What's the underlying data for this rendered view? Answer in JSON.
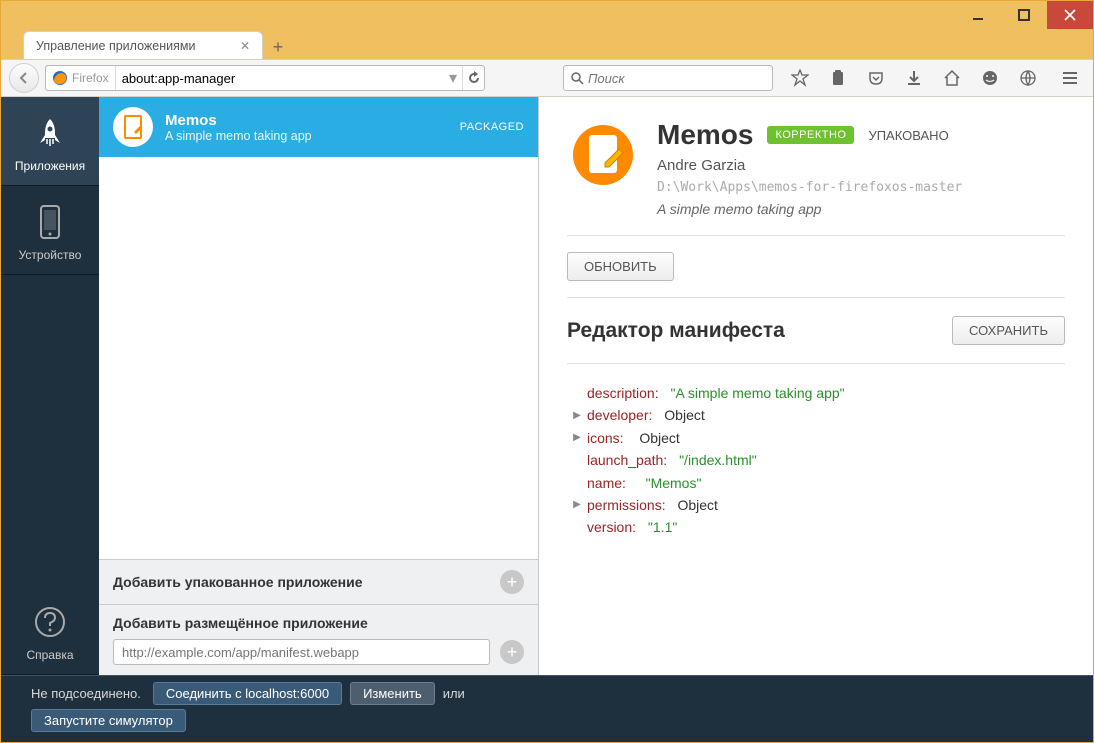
{
  "window": {
    "tab_title": "Управление приложениями"
  },
  "toolbar": {
    "identity_label": "Firefox",
    "url": "about:app-manager",
    "search_placeholder": "Поиск"
  },
  "leftnav": {
    "apps": "Приложения",
    "device": "Устройство",
    "help": "Справка"
  },
  "applist": {
    "item": {
      "name": "Memos",
      "subtitle": "A simple memo taking app",
      "tag": "PACKAGED"
    },
    "add_packaged": "Добавить упакованное приложение",
    "add_hosted": "Добавить размещённое приложение",
    "hosted_placeholder": "http://example.com/app/manifest.webapp"
  },
  "detail": {
    "name": "Memos",
    "valid": "КОРРЕКТНО",
    "packaged": "УПАКОВАНО",
    "author": "Andre Garzia",
    "path": "D:\\Work\\Apps\\memos-for-firefoxos-master",
    "desc": "A simple memo taking app",
    "update_btn": "ОБНОВИТЬ",
    "editor_title": "Редактор манифеста",
    "save_btn": "СОХРАНИТЬ"
  },
  "manifest": {
    "description_k": "description:",
    "description_v": "\"A simple memo taking app\"",
    "developer_k": "developer:",
    "developer_v": "Object",
    "icons_k": "icons:",
    "icons_v": "Object",
    "launch_path_k": "launch_path:",
    "launch_path_v": "\"/index.html\"",
    "name_k": "name:",
    "name_v": "\"Memos\"",
    "permissions_k": "permissions:",
    "permissions_v": "Object",
    "version_k": "version:",
    "version_v": "\"1.1\""
  },
  "footer": {
    "not_connected": "Не подсоединено.",
    "connect": "Соединить с localhost:6000",
    "change": "Изменить",
    "or": "или",
    "simulator": "Запустите симулятор"
  }
}
